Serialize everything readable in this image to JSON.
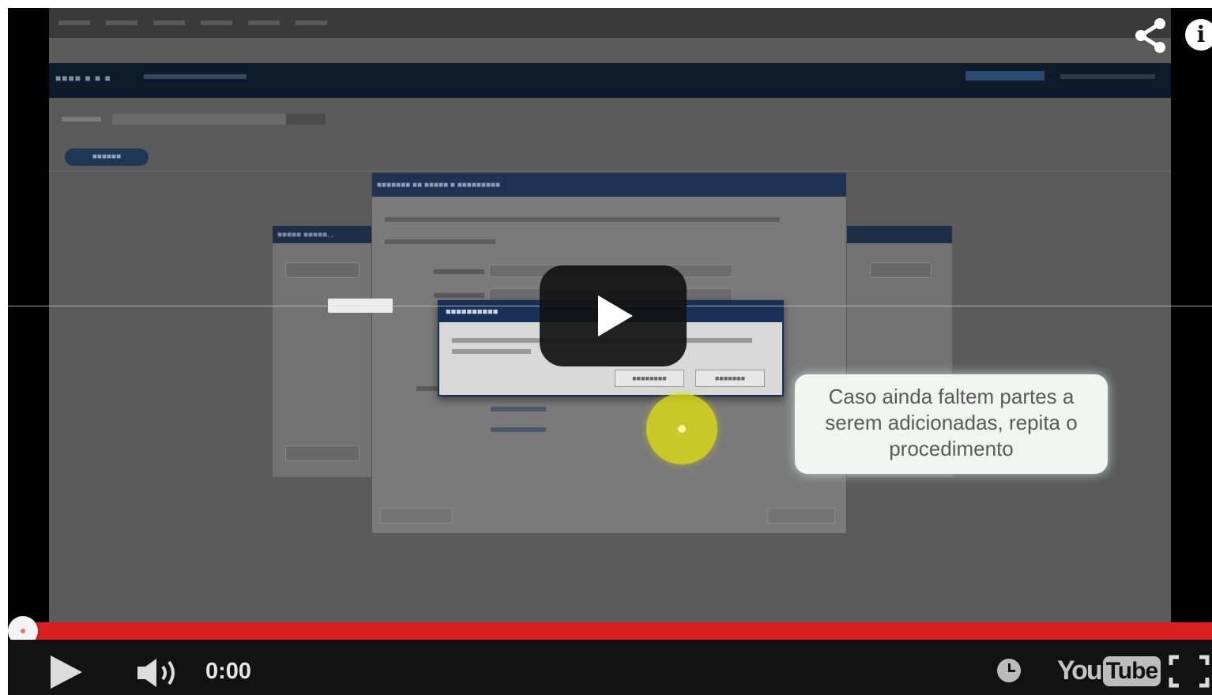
{
  "player": {
    "time_label": "0:00",
    "progress_fraction": 0.0,
    "logo_you": "You",
    "logo_tube": "Tube",
    "accent_color": "#d81e1e"
  },
  "video_frame": {
    "callout_text": "Caso ainda faltem partes a serem adicionadas, repita o procedimento"
  },
  "icons": {
    "share": "share-icon",
    "info": "info-icon",
    "play_large": "play-icon",
    "play": "play-icon",
    "volume": "volume-icon",
    "watch_later": "clock-icon",
    "fullscreen": "fullscreen-icon"
  }
}
